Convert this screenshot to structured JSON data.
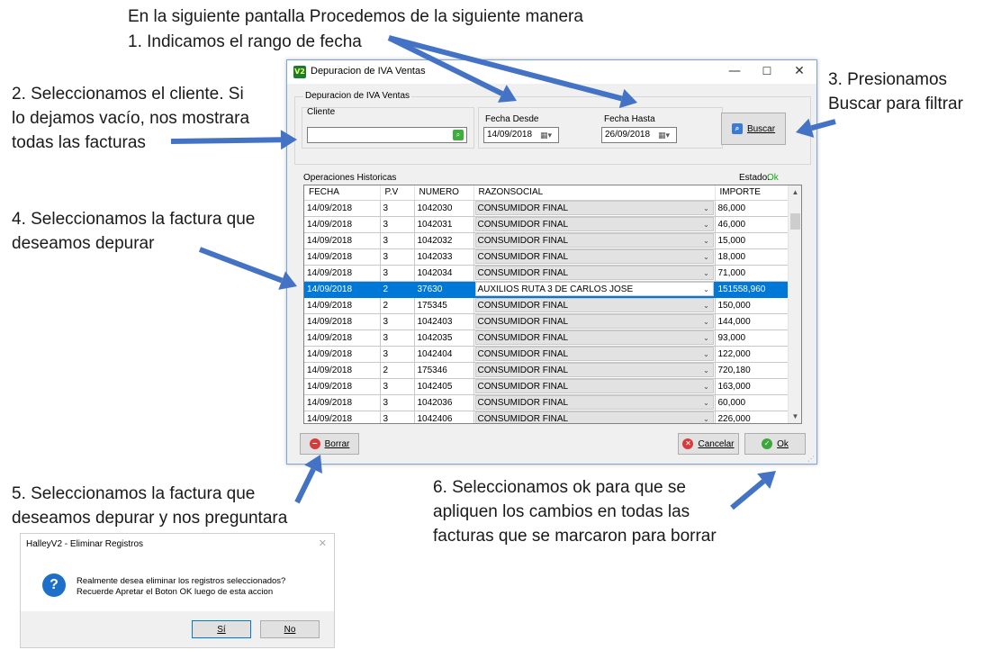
{
  "annotations": {
    "intro": "En la siguiente pantalla Procedemos de la siguiente manera",
    "step1": "1. Indicamos el rango de fecha",
    "step2": "2. Seleccionamos el cliente. Si\nlo dejamos vacío, nos mostrara\ntodas las facturas",
    "step3": "3. Presionamos\nBuscar para filtrar",
    "step4": "4. Seleccionamos la factura que\ndeseamos depurar",
    "step5": "5. Seleccionamos la factura que\ndeseamos depurar y nos preguntara",
    "step6": "6. Seleccionamos ok para que se\napliquen los cambios en todas las\nfacturas que se marcaron para borrar"
  },
  "window": {
    "app_icon": "V2",
    "title": "Depuracion de IVA Ventas",
    "minimize_glyph": "—",
    "maximize_glyph": "☐",
    "close_glyph": "✕"
  },
  "filter": {
    "group_label": "Depuracion de IVA Ventas",
    "cliente_label": "Cliente",
    "cliente_value": "",
    "fecha_desde_label": "Fecha Desde",
    "fecha_desde_value": "14/09/2018",
    "fecha_hasta_label": "Fecha Hasta",
    "fecha_hasta_value": "26/09/2018",
    "buscar_label": "Buscar"
  },
  "historic": {
    "group_label": "Operaciones Historicas",
    "estado_label": "Estado:",
    "estado_value": "Ok",
    "estado_color": "#1aa31a",
    "columns": [
      "FECHA",
      "P.V",
      "NUMERO",
      "RAZONSOCIAL",
      "IMPORTE"
    ],
    "selected_index": 5,
    "rows": [
      {
        "fecha": "14/09/2018",
        "pv": "3",
        "numero": "1042030",
        "razon": "CONSUMIDOR FINAL",
        "importe": "86,000"
      },
      {
        "fecha": "14/09/2018",
        "pv": "3",
        "numero": "1042031",
        "razon": "CONSUMIDOR FINAL",
        "importe": "46,000"
      },
      {
        "fecha": "14/09/2018",
        "pv": "3",
        "numero": "1042032",
        "razon": "CONSUMIDOR FINAL",
        "importe": "15,000"
      },
      {
        "fecha": "14/09/2018",
        "pv": "3",
        "numero": "1042033",
        "razon": "CONSUMIDOR FINAL",
        "importe": "18,000"
      },
      {
        "fecha": "14/09/2018",
        "pv": "3",
        "numero": "1042034",
        "razon": "CONSUMIDOR FINAL",
        "importe": "71,000"
      },
      {
        "fecha": "14/09/2018",
        "pv": "2",
        "numero": "37630",
        "razon": "AUXILIOS RUTA 3 DE CARLOS JOSE",
        "importe": "151558,960"
      },
      {
        "fecha": "14/09/2018",
        "pv": "2",
        "numero": "175345",
        "razon": "CONSUMIDOR FINAL",
        "importe": "150,000"
      },
      {
        "fecha": "14/09/2018",
        "pv": "3",
        "numero": "1042403",
        "razon": "CONSUMIDOR FINAL",
        "importe": "144,000"
      },
      {
        "fecha": "14/09/2018",
        "pv": "3",
        "numero": "1042035",
        "razon": "CONSUMIDOR FINAL",
        "importe": "93,000"
      },
      {
        "fecha": "14/09/2018",
        "pv": "3",
        "numero": "1042404",
        "razon": "CONSUMIDOR FINAL",
        "importe": "122,000"
      },
      {
        "fecha": "14/09/2018",
        "pv": "2",
        "numero": "175346",
        "razon": "CONSUMIDOR FINAL",
        "importe": "720,180"
      },
      {
        "fecha": "14/09/2018",
        "pv": "3",
        "numero": "1042405",
        "razon": "CONSUMIDOR FINAL",
        "importe": "163,000"
      },
      {
        "fecha": "14/09/2018",
        "pv": "3",
        "numero": "1042036",
        "razon": "CONSUMIDOR FINAL",
        "importe": "60,000"
      },
      {
        "fecha": "14/09/2018",
        "pv": "3",
        "numero": "1042406",
        "razon": "CONSUMIDOR FINAL",
        "importe": "226,000"
      }
    ]
  },
  "buttons": {
    "borrar": "Borrar",
    "cancelar": "Cancelar",
    "ok": "Ok"
  },
  "dialog": {
    "title": "HalleyV2 - Eliminar Registros",
    "close_glyph": "✕",
    "icon_glyph": "?",
    "message_line1": "Realmente desea eliminar los registros seleccionados?",
    "message_line2": "Recuerde Apretar el Boton OK luego de esta accion",
    "yes_label": "Sí",
    "no_label": "No"
  },
  "colors": {
    "arrow": "#4472c4",
    "selection": "#0078d7"
  }
}
